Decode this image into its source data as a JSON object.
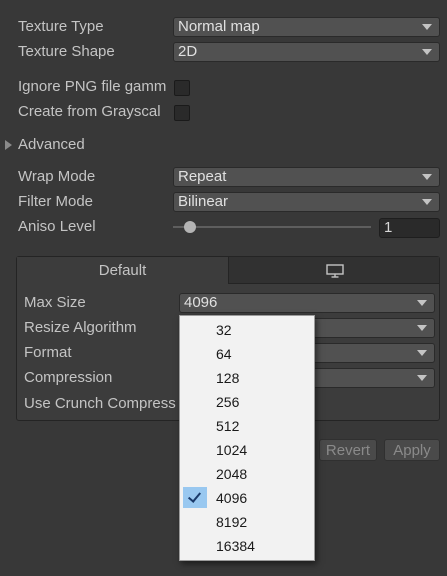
{
  "texture": {
    "type_label": "Texture Type",
    "type_value": "Normal map",
    "shape_label": "Texture Shape",
    "shape_value": "2D",
    "ignore_png_label": "Ignore PNG file gamm",
    "create_gray_label": "Create from Grayscal",
    "ignore_png_checked": false,
    "create_gray_checked": false
  },
  "advanced": {
    "label": "Advanced"
  },
  "wrap": {
    "label": "Wrap Mode",
    "value": "Repeat"
  },
  "filter": {
    "label": "Filter Mode",
    "value": "Bilinear"
  },
  "aniso": {
    "label": "Aniso Level",
    "value": "1",
    "level": 1
  },
  "platform": {
    "tabs": [
      {
        "label": "Default",
        "icon": "monitor-icon"
      }
    ],
    "max_size_label": "Max Size",
    "max_size_value": "4096",
    "resize_label": "Resize Algorithm",
    "format_label": "Format",
    "compression_label": "Compression",
    "crunch_label": "Use Crunch Compress"
  },
  "buttons": {
    "revert": "Revert",
    "apply": "Apply"
  },
  "menu": {
    "items": [
      "32",
      "64",
      "128",
      "256",
      "512",
      "1024",
      "2048",
      "4096",
      "8192",
      "16384"
    ],
    "selected": "4096"
  },
  "colors": {
    "background": "#383838",
    "menu_highlight": "#99c8f0"
  }
}
